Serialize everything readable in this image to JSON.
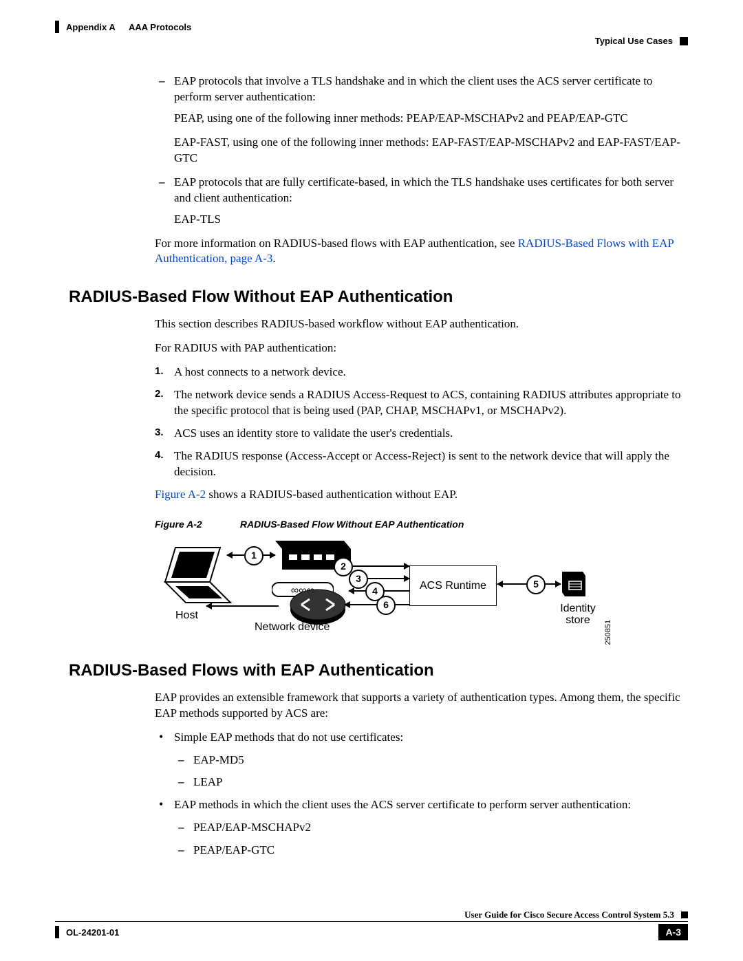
{
  "header": {
    "appendix": "Appendix A   AAA Protocols",
    "section": "Typical Use Cases"
  },
  "intro": {
    "dash1": "EAP protocols that involve a TLS handshake and in which the client uses the ACS server certificate to perform server authentication:",
    "dash1_p1": "PEAP, using one of the following inner methods: PEAP/EAP-MSCHAPv2 and PEAP/EAP-GTC",
    "dash1_p2": "EAP-FAST, using one of the following inner methods: EAP-FAST/EAP-MSCHAPv2 and EAP-FAST/EAP-GTC",
    "dash2": "EAP protocols that are fully certificate-based, in which the TLS handshake uses certificates for both server and client authentication:",
    "dash2_p1": "EAP-TLS",
    "moreinfo_pre": "For more information on RADIUS-based flows with EAP authentication, see ",
    "moreinfo_link": "RADIUS-Based Flows with EAP Authentication, page A-3",
    "moreinfo_post": "."
  },
  "sec1": {
    "heading": "RADIUS-Based Flow Without EAP Authentication",
    "p1": "This section describes RADIUS-based workflow without EAP authentication.",
    "p2": "For RADIUS with PAP authentication:",
    "steps": [
      "A host connects to a network device.",
      "The network device sends a RADIUS Access-Request to ACS, containing RADIUS attributes appropriate to the specific protocol that is being used (PAP, CHAP, MSCHAPv1, or MSCHAPv2).",
      "ACS uses an identity store to validate the user's credentials.",
      "The RADIUS response (Access-Accept or Access-Reject) is sent to the network device that will apply the decision."
    ],
    "figref_link": "Figure A-2",
    "figref_post": " shows a RADIUS-based authentication without EAP.",
    "fig_label": "Figure A-2",
    "fig_title": "RADIUS-Based Flow Without EAP Authentication"
  },
  "diagram": {
    "host": "Host",
    "netdev": "Network device",
    "acs": "ACS Runtime",
    "idstore_l1": "Identity",
    "idstore_l2": "store",
    "code": "250851",
    "n1": "1",
    "n2": "2",
    "n3": "3",
    "n4": "4",
    "n5": "5",
    "n6": "6"
  },
  "sec2": {
    "heading": "RADIUS-Based Flows with EAP Authentication",
    "p1": "EAP provides an extensible framework that supports a variety of authentication types. Among them, the specific EAP methods supported by ACS are:",
    "b1": "Simple EAP methods that do not use certificates:",
    "b1_d1": "EAP-MD5",
    "b1_d2": "LEAP",
    "b2": "EAP methods in which the client uses the ACS server certificate to perform server authentication:",
    "b2_d1": "PEAP/EAP-MSCHAPv2",
    "b2_d2": "PEAP/EAP-GTC"
  },
  "footer": {
    "guide": "User Guide for Cisco Secure Access Control System 5.3",
    "docnum": "OL-24201-01",
    "pagenum": "A-3"
  }
}
